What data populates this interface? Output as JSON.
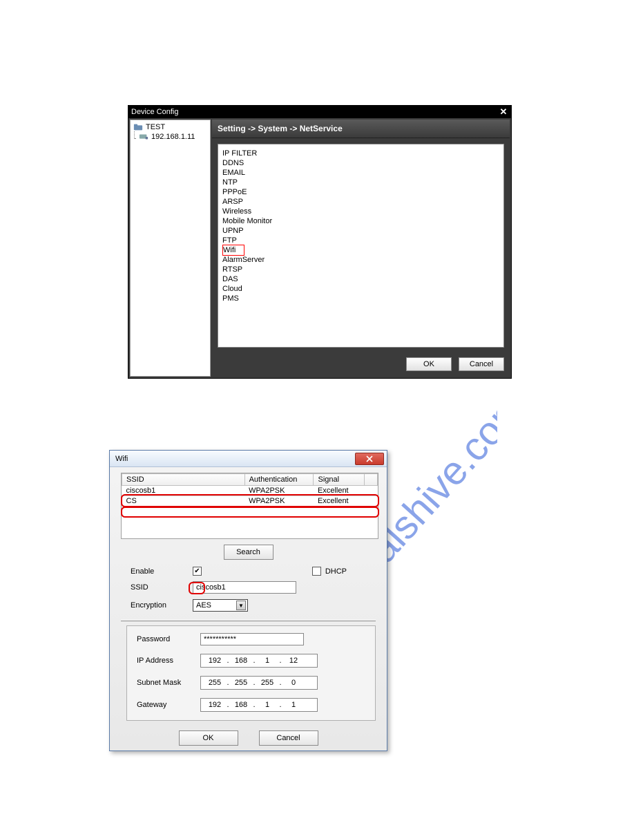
{
  "watermark": "manualshive.com",
  "win1": {
    "title": "Device Config",
    "tree": {
      "root": "TEST",
      "child": "192.168.1.11"
    },
    "breadcrumb": "Setting -> System -> NetService",
    "services": [
      "IP FILTER",
      "DDNS",
      "EMAIL",
      "NTP",
      "PPPoE",
      "ARSP",
      "Wireless",
      "Mobile Monitor",
      "UPNP",
      "FTP",
      "Wifi",
      "AlarmServer",
      "RTSP",
      "DAS",
      "Cloud",
      "PMS"
    ],
    "highlight_index": 10,
    "ok": "OK",
    "cancel": "Cancel"
  },
  "win2": {
    "title": "Wifi",
    "headers": {
      "ssid": "SSID",
      "auth": "Authentication",
      "signal": "Signal"
    },
    "rows": [
      {
        "ssid": "ciscosb1",
        "auth": "WPA2PSK",
        "signal": "Excellent"
      },
      {
        "ssid": "CS",
        "auth": "WPA2PSK",
        "signal": "Excellent"
      }
    ],
    "search_btn": "Search",
    "labels": {
      "enable": "Enable",
      "dhcp": "DHCP",
      "ssid": "SSID",
      "encryption": "Encryption",
      "password": "Password",
      "ip": "IP Address",
      "subnet": "Subnet Mask",
      "gateway": "Gateway"
    },
    "enable_checked": "✔",
    "dhcp_checked": "",
    "ssid_value": "ciscosb1",
    "encryption_value": "AES",
    "password_value": "***********",
    "ip": [
      "192",
      "168",
      "1",
      "12"
    ],
    "subnet": [
      "255",
      "255",
      "255",
      "0"
    ],
    "gateway": [
      "192",
      "168",
      "1",
      "1"
    ],
    "ok": "OK",
    "cancel": "Cancel"
  }
}
